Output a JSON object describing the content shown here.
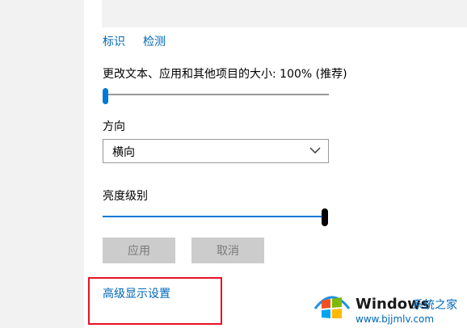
{
  "nav": {
    "link1": "标识",
    "link2": "检测"
  },
  "scale": {
    "label": "更改文本、应用和其他项目的大小: 100% (推荐)",
    "level": 0
  },
  "orientation": {
    "label": "方向",
    "selected": "横向"
  },
  "brightness": {
    "label": "亮度级别",
    "level": 1.0
  },
  "buttons": {
    "apply": "应用",
    "cancel": "取消"
  },
  "advanced_link": "高级显示设置",
  "watermark": {
    "brand": "Windows",
    "cn": "系统之家",
    "url": "www.bjjmlv.com"
  },
  "colors": {
    "accent": "#0078d7",
    "link": "#0067b8",
    "highlight_box": "#e81123"
  }
}
